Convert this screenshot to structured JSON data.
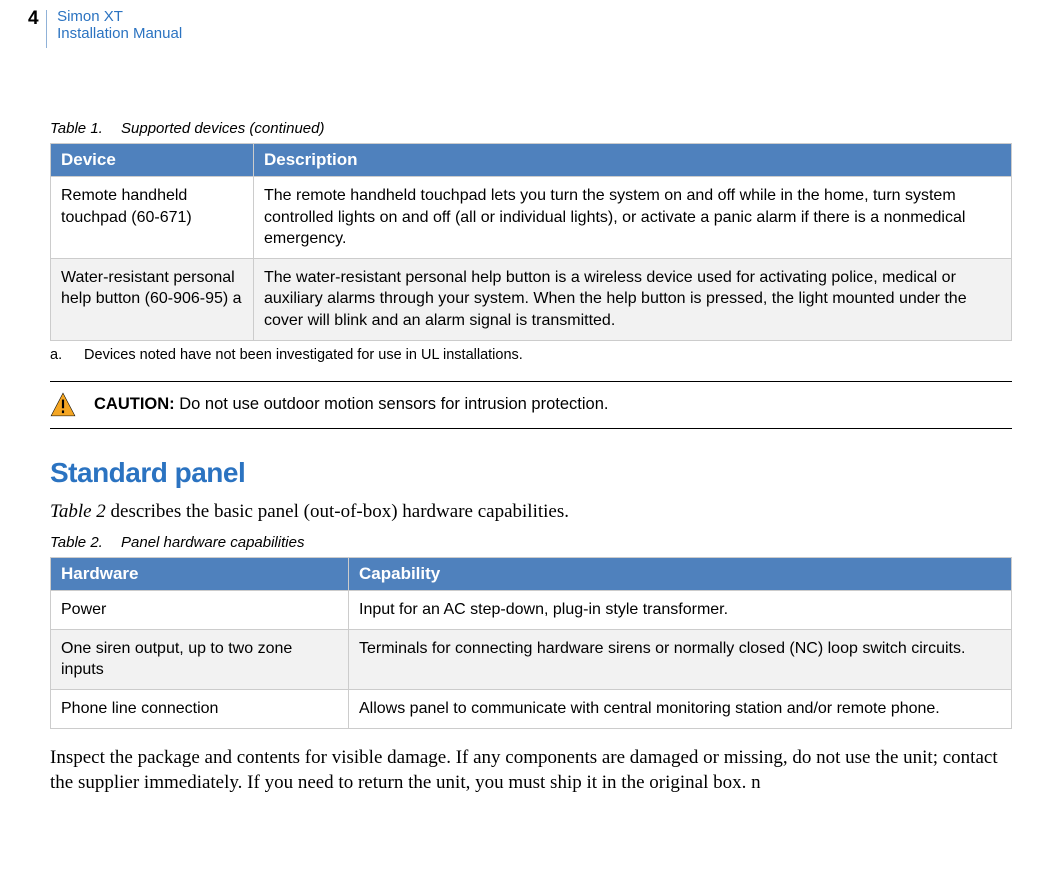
{
  "header": {
    "page_number": "4",
    "line1": "Simon XT",
    "line2": "Installation Manual"
  },
  "table1": {
    "caption_num": "Table 1.",
    "caption_title": "Supported devices (continued)",
    "headers": {
      "col1": "Device",
      "col2": "Description"
    },
    "rows": [
      {
        "device": "Remote handheld touchpad (60-671)",
        "description": "The remote handheld touchpad lets you turn the system on and off while in the home, turn system controlled lights on and off (all or individual lights), or activate a panic alarm if there is a nonmedical emergency."
      },
      {
        "device": "Water-resistant personal help button (60-906-95) a",
        "description": "The water-resistant personal help button is a wireless device used for activating police, medical or auxiliary alarms through your system.  When the help button is pressed, the light mounted under the cover will blink and an alarm signal is transmitted."
      }
    ],
    "footnote_mark": "a.",
    "footnote_text": "Devices noted have not been investigated for use in UL installations."
  },
  "caution": {
    "label": "CAUTION:",
    "text": " Do not use outdoor motion sensors for intrusion protection."
  },
  "section_heading": "Standard panel",
  "intro_paragraph_before": "Table 2",
  "intro_paragraph_after": " describes the basic panel (out-of-box) hardware capabilities.",
  "table2": {
    "caption_num": "Table 2.",
    "caption_title": "Panel hardware capabilities",
    "headers": {
      "col1": "Hardware",
      "col2": "Capability"
    },
    "rows": [
      {
        "hardware": "Power",
        "capability": "Input for an AC step-down, plug-in style transformer."
      },
      {
        "hardware": "One siren output, up to two zone inputs",
        "capability": "Terminals for connecting hardware sirens or normally closed (NC) loop switch circuits."
      },
      {
        "hardware": "Phone line connection",
        "capability": "Allows panel to communicate with central monitoring station and/or remote phone."
      }
    ]
  },
  "trailing_paragraph": "Inspect the package and contents for visible damage. If any components are damaged or missing, do not use the unit; contact the supplier immediately. If you need to return the unit, you must ship it in the original box. n"
}
